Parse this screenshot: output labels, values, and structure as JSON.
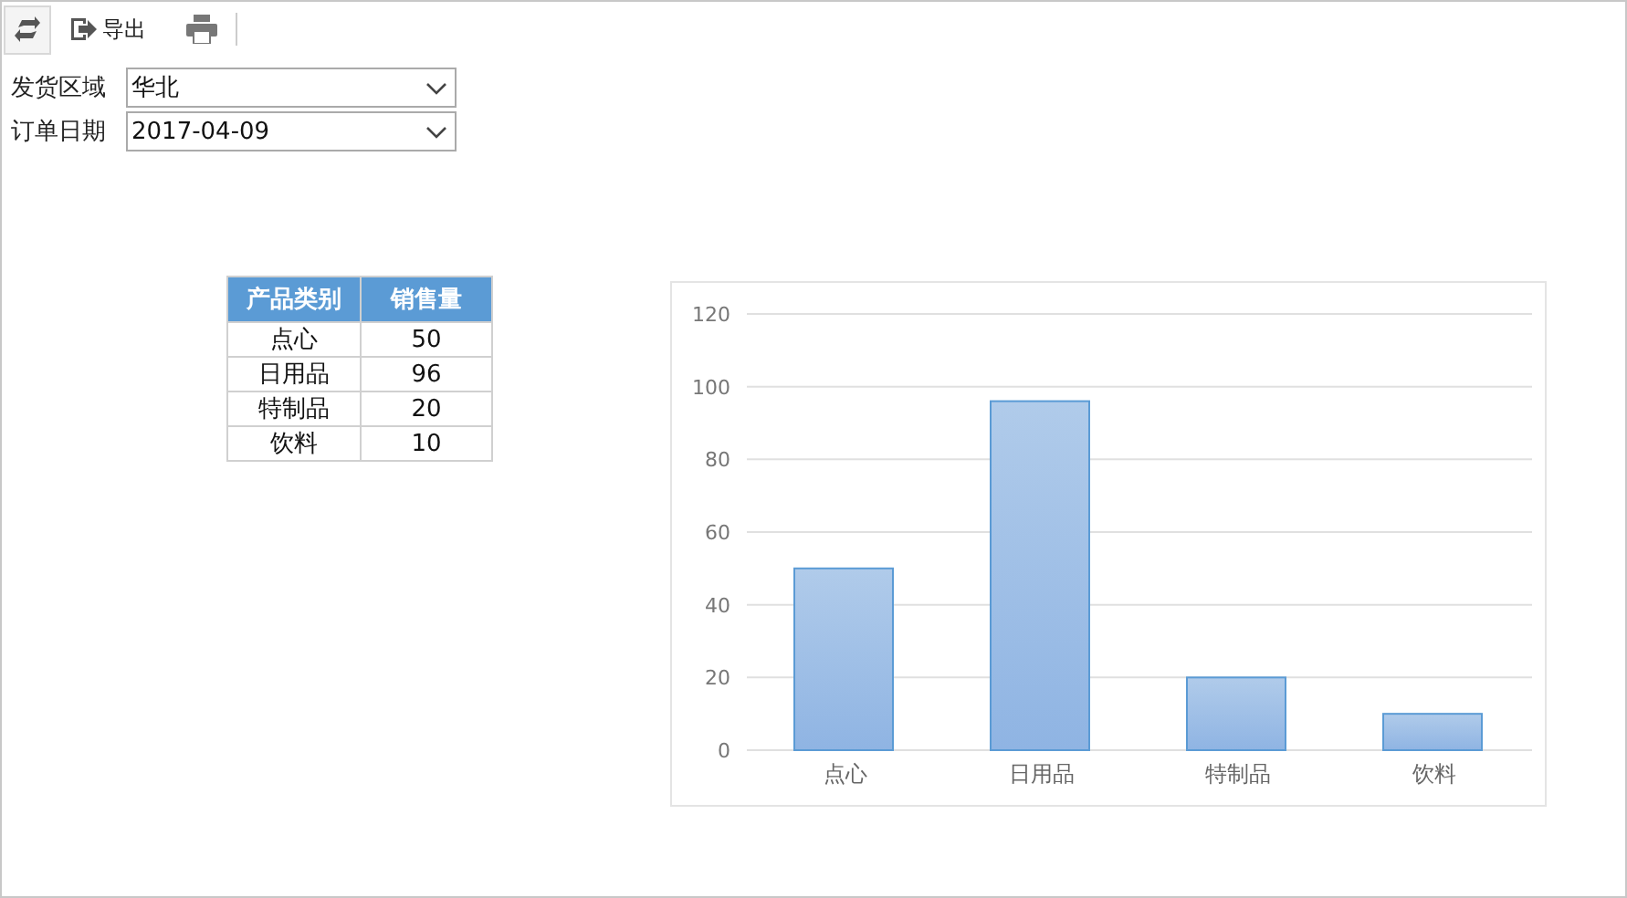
{
  "toolbar": {
    "export_label": "导出"
  },
  "filters": [
    {
      "label": "发货区域",
      "value": "华北"
    },
    {
      "label": "订单日期",
      "value": "2017-04-09"
    }
  ],
  "table": {
    "columns": [
      "产品类别",
      "销售量"
    ],
    "rows": [
      [
        "点心",
        "50"
      ],
      [
        "日用品",
        "96"
      ],
      [
        "特制品",
        "20"
      ],
      [
        "饮料",
        "10"
      ]
    ]
  },
  "chart": {
    "chart_data": {
      "type": "bar",
      "categories": [
        "点心",
        "日用品",
        "特制品",
        "饮料"
      ],
      "series": [
        {
          "color": "#5b9bd5",
          "values": [
            50,
            96,
            20,
            10
          ]
        }
      ],
      "grid": true,
      "ylim": [
        0,
        120
      ],
      "yticks": [
        0,
        20,
        40,
        60,
        80,
        100,
        120
      ]
    }
  }
}
